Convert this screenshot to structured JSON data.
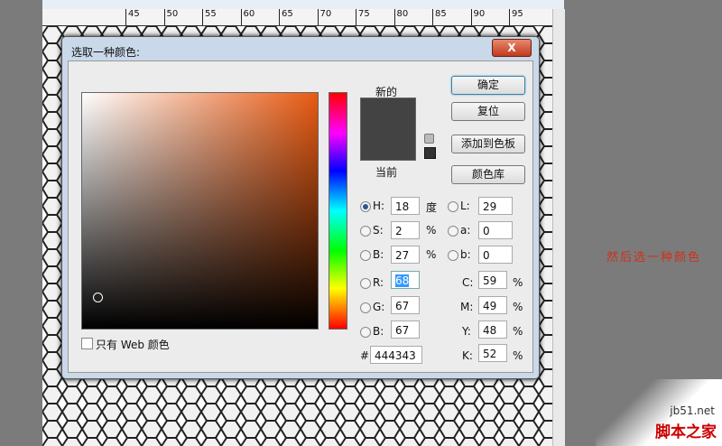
{
  "ruler": {
    "ticks": [
      "45",
      "50",
      "55",
      "60",
      "65",
      "70",
      "75",
      "80",
      "85",
      "90",
      "95"
    ]
  },
  "dialog": {
    "title": "选取一种颜色:",
    "close_label": "X",
    "new_label": "新的",
    "current_label": "当前",
    "buttons": {
      "ok": "确定",
      "reset": "复位",
      "add_swatch": "添加到色板",
      "color_libraries": "颜色库"
    },
    "web_only_label": "只有 Web 颜色",
    "fields": {
      "H": {
        "label": "H:",
        "value": "18",
        "unit": "度"
      },
      "S": {
        "label": "S:",
        "value": "2",
        "unit": "%"
      },
      "B": {
        "label": "B:",
        "value": "27",
        "unit": "%"
      },
      "R": {
        "label": "R:",
        "value": "68"
      },
      "G": {
        "label": "G:",
        "value": "67"
      },
      "B2": {
        "label": "B:",
        "value": "67"
      },
      "L": {
        "label": "L:",
        "value": "29"
      },
      "a": {
        "label": "a:",
        "value": "0"
      },
      "b": {
        "label": "b:",
        "value": "0"
      },
      "C": {
        "label": "C:",
        "value": "59",
        "unit": "%"
      },
      "M": {
        "label": "M:",
        "value": "49",
        "unit": "%"
      },
      "Y": {
        "label": "Y:",
        "value": "48",
        "unit": "%"
      },
      "K": {
        "label": "K:",
        "value": "52",
        "unit": "%"
      },
      "hex": {
        "label": "#",
        "value": "444343"
      }
    },
    "new_color": "#444343",
    "current_color": "#444343"
  },
  "annotation": "然后选一种颜色",
  "watermark": {
    "url": "jb51.net",
    "name": "脚本之家"
  }
}
